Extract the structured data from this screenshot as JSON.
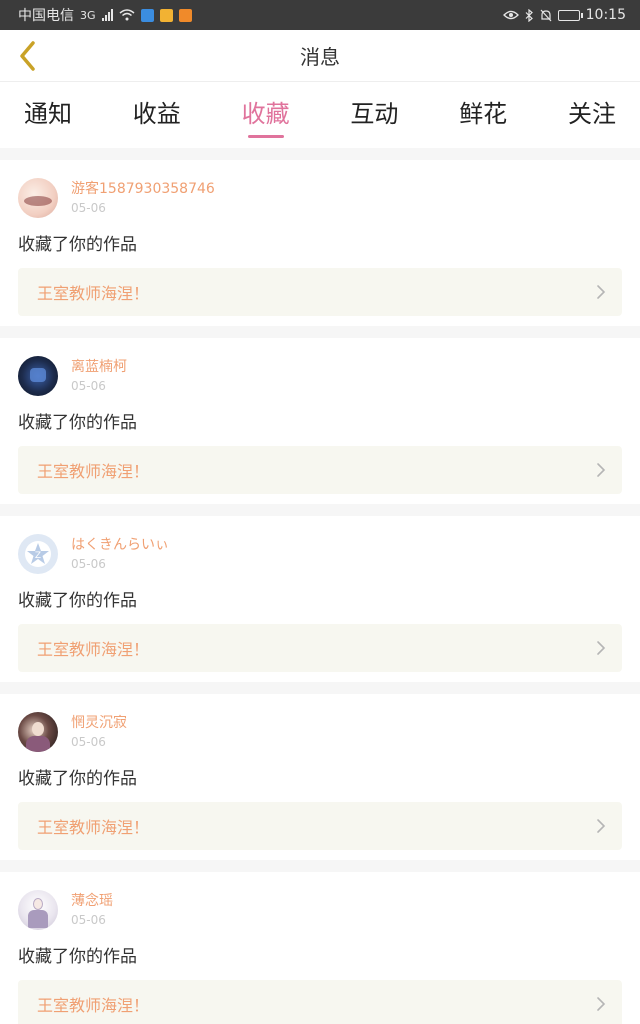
{
  "status_bar": {
    "carrier": "中国电信",
    "network": "3G",
    "time": "10:15"
  },
  "nav": {
    "title": "消息",
    "back_icon": "chevron-left-icon",
    "accent": "#c9a227"
  },
  "tabs": [
    {
      "label": "通知",
      "active": false
    },
    {
      "label": "收益",
      "active": false
    },
    {
      "label": "收藏",
      "active": true
    },
    {
      "label": "互动",
      "active": false
    },
    {
      "label": "鲜花",
      "active": false
    },
    {
      "label": "关注",
      "active": false
    }
  ],
  "colors": {
    "active_tab": "#e0739c",
    "username": "#f0a073",
    "work_title": "#f0a073"
  },
  "notifications": [
    {
      "username": "游客1587930358746",
      "date": "05-06",
      "action": "收藏了你的作品",
      "work": "王室教师海涅！"
    },
    {
      "username": "离蓝楠柯",
      "date": "05-06",
      "action": "收藏了你的作品",
      "work": "王室教师海涅！"
    },
    {
      "username": "はくきんらいぃ",
      "date": "05-06",
      "action": "收藏了你的作品",
      "work": "王室教师海涅！"
    },
    {
      "username": "惘灵沉寂",
      "date": "05-06",
      "action": "收藏了你的作品",
      "work": "王室教师海涅！"
    },
    {
      "username": "薄念瑶",
      "date": "05-06",
      "action": "收藏了你的作品",
      "work": "王室教师海涅！"
    }
  ]
}
